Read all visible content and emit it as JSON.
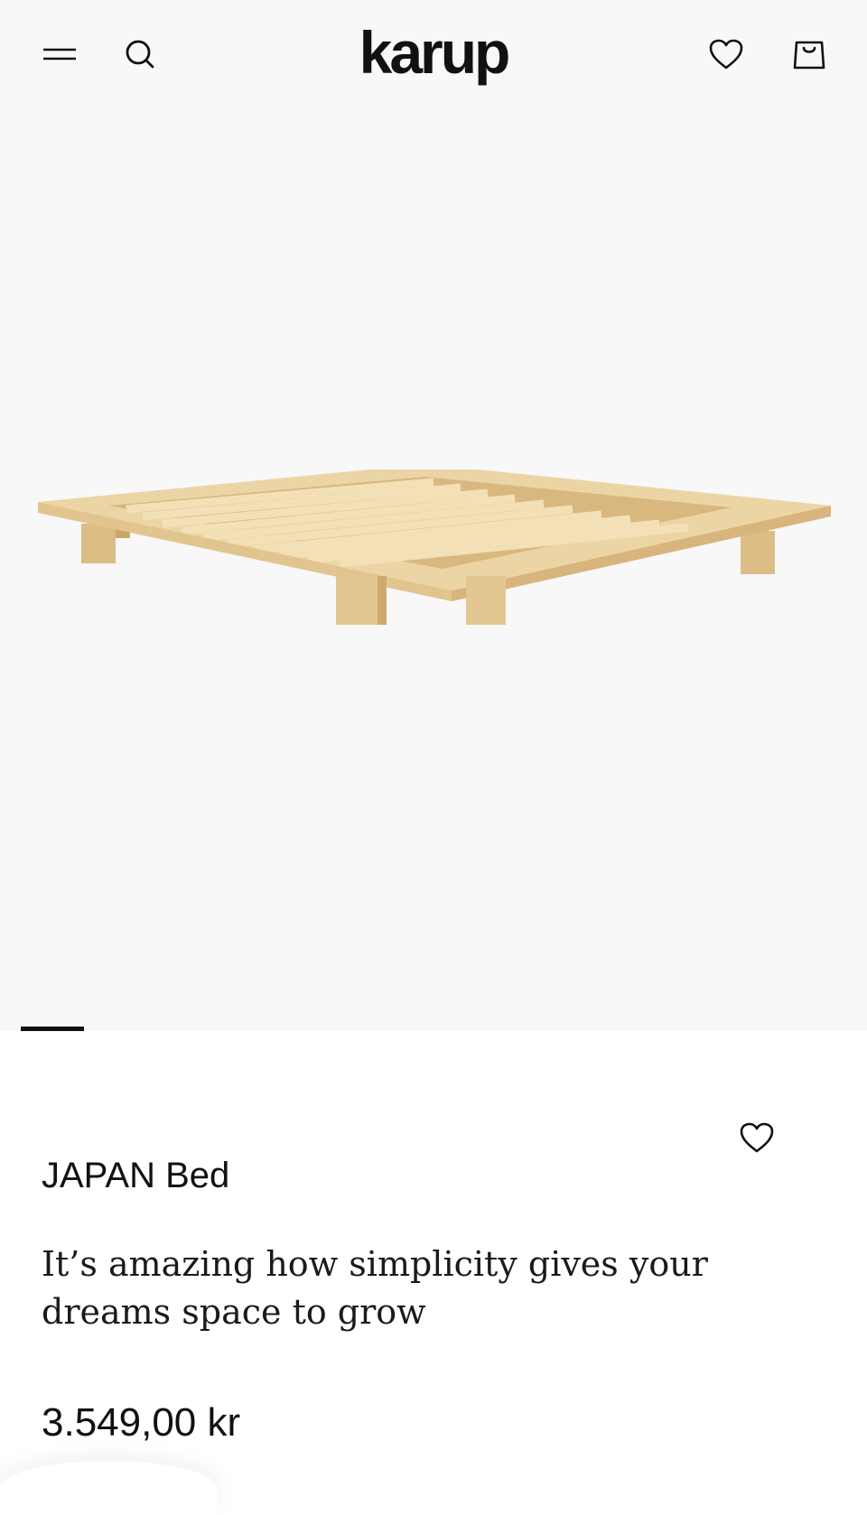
{
  "header": {
    "logo_text": "karup",
    "icons": {
      "menu": "hamburger-menu-icon",
      "search": "search-icon",
      "wishlist": "heart-icon",
      "cart": "shopping-bag-icon"
    }
  },
  "gallery": {
    "image_alt": "JAPAN Bed wooden frame",
    "current_slide": 1
  },
  "product": {
    "title": "JAPAN Bed",
    "tagline": "It’s amazing how simplicity gives your dreams space to grow",
    "price": "3.549,00 kr"
  },
  "colors": {
    "hero_background": "#f8f8f9",
    "text": "#111111",
    "wood": "#e9cf9b"
  }
}
